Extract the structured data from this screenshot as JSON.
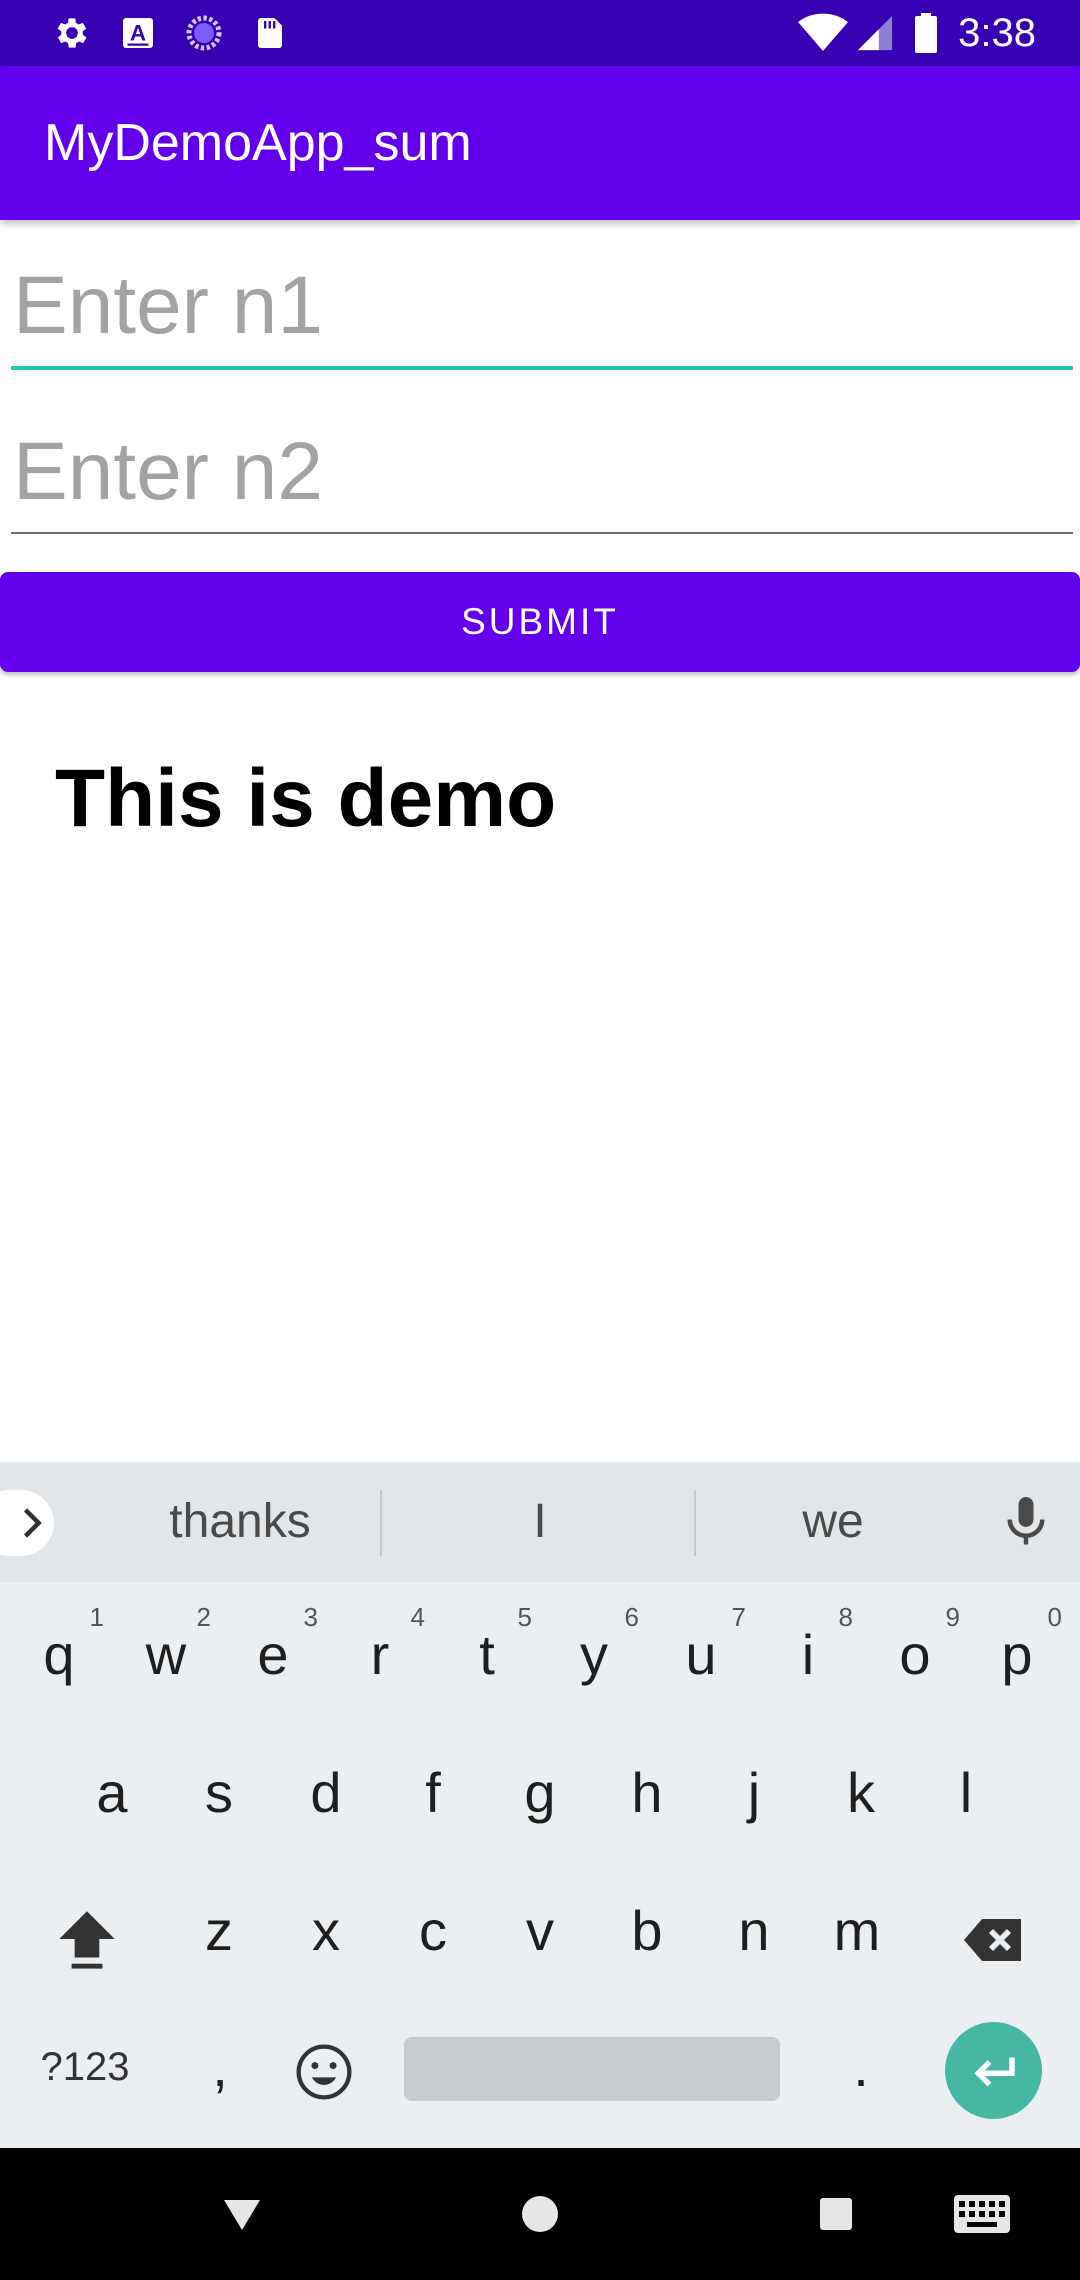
{
  "status_bar": {
    "time": "3:38",
    "left_icons": [
      "gear-icon",
      "text-a-icon",
      "loading-circle-icon",
      "sd-card-icon"
    ],
    "right_icons": [
      "wifi-icon",
      "signal-icon",
      "battery-icon"
    ]
  },
  "app_bar": {
    "title": "MyDemoApp_sum"
  },
  "form": {
    "n1": {
      "placeholder": "Enter n1",
      "value": ""
    },
    "n2": {
      "placeholder": "Enter n2",
      "value": ""
    },
    "submit_label": "SUBMIT",
    "result_text": "This is demo"
  },
  "keyboard": {
    "suggestions": [
      "thanks",
      "I",
      "we"
    ],
    "row1": [
      {
        "key": "q",
        "hint": "1"
      },
      {
        "key": "w",
        "hint": "2"
      },
      {
        "key": "e",
        "hint": "3"
      },
      {
        "key": "r",
        "hint": "4"
      },
      {
        "key": "t",
        "hint": "5"
      },
      {
        "key": "y",
        "hint": "6"
      },
      {
        "key": "u",
        "hint": "7"
      },
      {
        "key": "i",
        "hint": "8"
      },
      {
        "key": "o",
        "hint": "9"
      },
      {
        "key": "p",
        "hint": "0"
      }
    ],
    "row2": [
      "a",
      "s",
      "d",
      "f",
      "g",
      "h",
      "j",
      "k",
      "l"
    ],
    "row3": [
      "z",
      "x",
      "c",
      "v",
      "b",
      "n",
      "m"
    ],
    "symbols_label": "?123",
    "comma_label": ",",
    "period_label": "."
  },
  "colors": {
    "status_bar": "#3700b3",
    "primary": "#6200ee",
    "accent": "#20c5b8",
    "enter_key": "#46b7a5"
  }
}
